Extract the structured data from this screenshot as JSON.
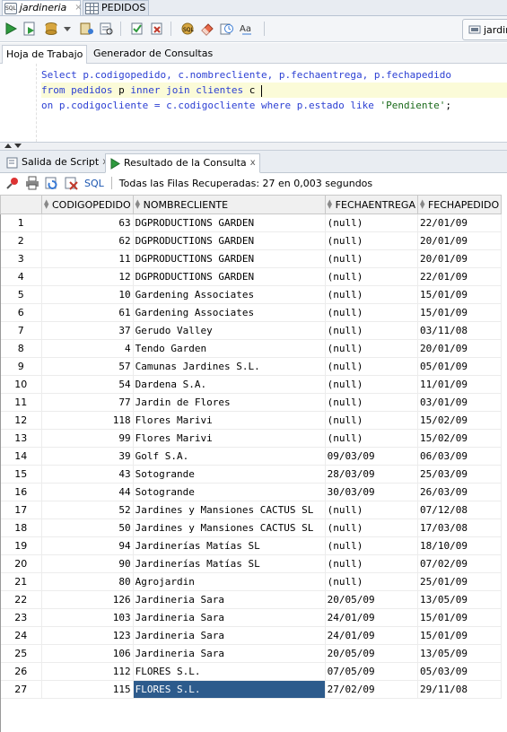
{
  "doc_tabs": [
    {
      "label": "jardineria",
      "icon": "sql-connection-icon",
      "closable": true
    },
    {
      "label": "PEDIDOS",
      "icon": "table-icon",
      "closable": false
    }
  ],
  "connection_label": "jardin",
  "editor_tabs": [
    "Hoja de Trabajo",
    "Generador de Consultas"
  ],
  "query_lines": [
    [
      {
        "t": "Select p.codigopedido, c.nombrecliente, p.fechaentrega, p.fechapedido",
        "c": "kw"
      }
    ],
    [
      {
        "t": "from pedidos ",
        "c": "kw"
      },
      {
        "t": "p ",
        "c": ""
      },
      {
        "t": "inner join clientes ",
        "c": "kw"
      },
      {
        "t": "c ",
        "c": ""
      }
    ],
    [
      {
        "t": "on p.codigocliente = c.codigocliente where p.estado like ",
        "c": "kw"
      },
      {
        "t": "'Pendiente'",
        "c": "str"
      },
      {
        "t": ";",
        "c": ""
      }
    ]
  ],
  "result_tabs": [
    {
      "label": "Salida de Script",
      "closable": true
    },
    {
      "label": "Resultado de la Consulta",
      "closable": true
    }
  ],
  "result_toolbar": {
    "sql_label": "SQL",
    "status": "Todas las Filas Recuperadas: 27 en 0,003 segundos"
  },
  "columns": [
    "CODIGOPEDIDO",
    "NOMBRECLIENTE",
    "FECHAENTREGA",
    "FECHAPEDIDO"
  ],
  "rows": [
    [
      "1",
      "63",
      "DGPRODUCTIONS GARDEN",
      "(null)",
      "22/01/09"
    ],
    [
      "2",
      "62",
      "DGPRODUCTIONS GARDEN",
      "(null)",
      "20/01/09"
    ],
    [
      "3",
      "11",
      "DGPRODUCTIONS GARDEN",
      "(null)",
      "20/01/09"
    ],
    [
      "4",
      "12",
      "DGPRODUCTIONS GARDEN",
      "(null)",
      "22/01/09"
    ],
    [
      "5",
      "10",
      "Gardening Associates",
      "(null)",
      "15/01/09"
    ],
    [
      "6",
      "61",
      "Gardening Associates",
      "(null)",
      "15/01/09"
    ],
    [
      "7",
      "37",
      "Gerudo Valley",
      "(null)",
      "03/11/08"
    ],
    [
      "8",
      "4",
      "Tendo Garden",
      "(null)",
      "20/01/09"
    ],
    [
      "9",
      "57",
      "Camunas Jardines S.L.",
      "(null)",
      "05/01/09"
    ],
    [
      "10",
      "54",
      "Dardena S.A.",
      "(null)",
      "11/01/09"
    ],
    [
      "11",
      "77",
      "Jardin de Flores",
      "(null)",
      "03/01/09"
    ],
    [
      "12",
      "118",
      "Flores Marivi",
      "(null)",
      "15/02/09"
    ],
    [
      "13",
      "99",
      "Flores Marivi",
      "(null)",
      "15/02/09"
    ],
    [
      "14",
      "39",
      "Golf S.A.",
      "09/03/09",
      "06/03/09"
    ],
    [
      "15",
      "43",
      "Sotogrande",
      "28/03/09",
      "25/03/09"
    ],
    [
      "16",
      "44",
      "Sotogrande",
      "30/03/09",
      "26/03/09"
    ],
    [
      "17",
      "52",
      "Jardines y Mansiones CACTUS SL",
      "(null)",
      "07/12/08"
    ],
    [
      "18",
      "50",
      "Jardines y Mansiones CACTUS SL",
      "(null)",
      "17/03/08"
    ],
    [
      "19",
      "94",
      "Jardinerías Matías SL",
      "(null)",
      "18/10/09"
    ],
    [
      "20",
      "90",
      "Jardinerías Matías SL",
      "(null)",
      "07/02/09"
    ],
    [
      "21",
      "80",
      "Agrojardin",
      "(null)",
      "25/01/09"
    ],
    [
      "22",
      "126",
      "Jardineria Sara",
      "20/05/09",
      "13/05/09"
    ],
    [
      "23",
      "103",
      "Jardineria Sara",
      "24/01/09",
      "15/01/09"
    ],
    [
      "24",
      "123",
      "Jardineria Sara",
      "24/01/09",
      "15/01/09"
    ],
    [
      "25",
      "106",
      "Jardineria Sara",
      "20/05/09",
      "13/05/09"
    ],
    [
      "26",
      "112",
      "FLORES S.L.",
      "07/05/09",
      "05/03/09"
    ],
    [
      "27",
      "115",
      "FLORES S.L.",
      "27/02/09",
      "29/11/08"
    ]
  ],
  "selected_cell": {
    "row": 27,
    "column": "NOMBRECLIENTE"
  }
}
